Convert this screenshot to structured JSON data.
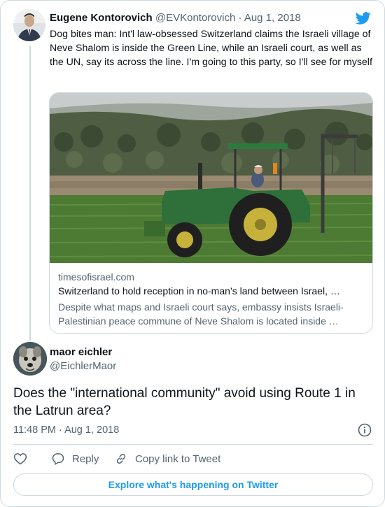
{
  "parent_tweet": {
    "name": "Eugene Kontorovich",
    "handle": "@EVKontorovich",
    "separator": " · ",
    "date": "Aug 1, 2018",
    "text": "Dog bites man: Int'l law-obsessed Switzerland claims the Israeli village of Neve Shalom is inside the Green Line, while an Israeli court, as well as the UN, say its across the line. I'm going to this party, so I'll see for myself",
    "link_card": {
      "domain": "timesofisrael.com",
      "title": "Switzerland to hold reception in no-man’s land between Israel, …",
      "description": "Despite what maps and Israeli court says, embassy insists Israeli-Palestinian peace commune of Neve Shalom is located inside …",
      "image": "tractor-in-field-photo"
    }
  },
  "main_tweet": {
    "name": "maor eichler",
    "handle": "@EichlerMaor",
    "text": "Does the \"international community\" avoid using Route 1 in the Latrun area?",
    "timestamp": "11:48 PM · Aug 1, 2018"
  },
  "actions": {
    "like_icon": "heart-icon",
    "reply_label": "Reply",
    "reply_icon": "speech-bubble-icon",
    "copy_label": "Copy link to Tweet",
    "copy_icon": "link-icon"
  },
  "explore_label": "Explore what's happening on Twitter",
  "colors": {
    "accent": "#1d9bf0",
    "text": "#0f1419",
    "secondary": "#536471",
    "border": "#cfd9de"
  }
}
